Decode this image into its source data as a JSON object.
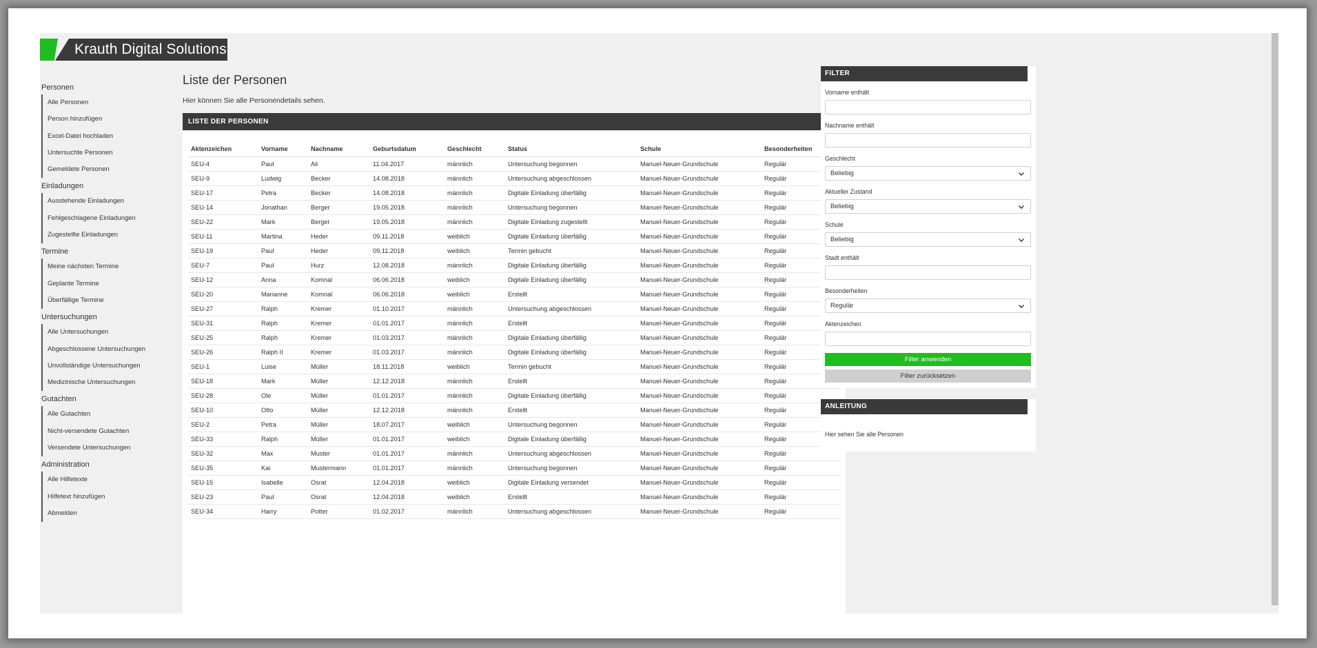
{
  "brand": {
    "name": "Krauth Digital Solutions",
    "accent": "#1fbd1f",
    "dark": "#3a3a3a"
  },
  "sidebar": {
    "sections": [
      {
        "title": "Personen",
        "items": [
          "Alle Personen",
          "Person hinzufügen",
          "Excel-Datei hochladen",
          "Untersuchte Personen",
          "Gemeldete Personen"
        ]
      },
      {
        "title": "Einladungen",
        "items": [
          "Ausstehende Einladungen",
          "Fehlgeschlagene Einladungen",
          "Zugestellte Einladungen"
        ]
      },
      {
        "title": "Termine",
        "items": [
          "Meine nächsten Termine",
          "Geplante Termine",
          "Überfällige Termine"
        ]
      },
      {
        "title": "Untersuchungen",
        "items": [
          "Alle Untersuchungen",
          "Abgeschlossene Untersuchungen",
          "Unvollständige Untersuchungen",
          "Medizinische Untersuchungen"
        ]
      },
      {
        "title": "Gutachten",
        "items": [
          "Alle Gutachten",
          "Nicht-versendete Gutachten",
          "Versendete Untersuchungen"
        ]
      },
      {
        "title": "Administration",
        "items": [
          "Alle Hilfetexte",
          "Hilfetext hinzufügen",
          "Abmelden"
        ]
      }
    ]
  },
  "main": {
    "title": "Liste der Personen",
    "subtitle": "Hier können Sie alle Personendetails sehen.",
    "panel_title": "LISTE DER PERSONEN",
    "columns": [
      "Aktenzeichen",
      "Vorname",
      "Nachname",
      "Geburtsdatum",
      "Geschlecht",
      "Status",
      "Schule",
      "Besonderheiten"
    ],
    "rows": [
      [
        "SEU-4",
        "Paul",
        "Ali",
        "11.04.2017",
        "männlich",
        "Untersuchung begonnen",
        "Manuel-Neuer-Grundschule",
        "Regulär"
      ],
      [
        "SEU-9",
        "Ludwig",
        "Becker",
        "14.08.2018",
        "männlich",
        "Untersuchung abgeschlossen",
        "Manuel-Neuer-Grundschule",
        "Regulär"
      ],
      [
        "SEU-17",
        "Petra",
        "Becker",
        "14.08.2018",
        "männlich",
        "Digitale Einladung überfällig",
        "Manuel-Neuer-Grundschule",
        "Regulär"
      ],
      [
        "SEU-14",
        "Jonathan",
        "Berger",
        "19.05.2018",
        "männlich",
        "Untersuchung begonnen",
        "Manuel-Neuer-Grundschule",
        "Regulär"
      ],
      [
        "SEU-22",
        "Mark",
        "Berger",
        "19.05.2018",
        "männlich",
        "Digitale Einladung zugestellt",
        "Manuel-Neuer-Grundschule",
        "Regulär"
      ],
      [
        "SEU-11",
        "Martina",
        "Heder",
        "09.11.2018",
        "weiblich",
        "Digitale Einladung überfällig",
        "Manuel-Neuer-Grundschule",
        "Regulär"
      ],
      [
        "SEU-19",
        "Paul",
        "Heder",
        "09.11.2018",
        "weiblich",
        "Termin gebucht",
        "Manuel-Neuer-Grundschule",
        "Regulär"
      ],
      [
        "SEU-7",
        "Paul",
        "Hurz",
        "12.08.2018",
        "männlich",
        "Digitale Einladung überfällig",
        "Manuel-Neuer-Grundschule",
        "Regulär"
      ],
      [
        "SEU-12",
        "Anna",
        "Komnal",
        "06.06.2018",
        "weiblich",
        "Digitale Einladung überfällig",
        "Manuel-Neuer-Grundschule",
        "Regulär"
      ],
      [
        "SEU-20",
        "Marianne",
        "Komnal",
        "06.06.2018",
        "weiblich",
        "Erstellt",
        "Manuel-Neuer-Grundschule",
        "Regulär"
      ],
      [
        "SEU-27",
        "Ralph",
        "Kremer",
        "01.10.2017",
        "männlich",
        "Untersuchung abgeschlossen",
        "Manuel-Neuer-Grundschule",
        "Regulär"
      ],
      [
        "SEU-31",
        "Ralph",
        "Kremer",
        "01.01.2017",
        "männlich",
        "Erstellt",
        "Manuel-Neuer-Grundschule",
        "Regulär"
      ],
      [
        "SEU-25",
        "Ralph",
        "Kremer",
        "01.03.2017",
        "männlich",
        "Digitale Einladung überfällig",
        "Manuel-Neuer-Grundschule",
        "Regulär"
      ],
      [
        "SEU-26",
        "Ralph II",
        "Kremer",
        "01.03.2017",
        "männlich",
        "Digitale Einladung überfällig",
        "Manuel-Neuer-Grundschule",
        "Regulär"
      ],
      [
        "SEU-1",
        "Luise",
        "Müller",
        "18.11.2018",
        "weiblich",
        "Termin gebucht",
        "Manuel-Neuer-Grundschule",
        "Regulär"
      ],
      [
        "SEU-18",
        "Mark",
        "Müller",
        "12.12.2018",
        "männlich",
        "Erstellt",
        "Manuel-Neuer-Grundschule",
        "Regulär"
      ],
      [
        "SEU-28",
        "Ole",
        "Müller",
        "01.01.2017",
        "männlich",
        "Digitale Einladung überfällig",
        "Manuel-Neuer-Grundschule",
        "Regulär"
      ],
      [
        "SEU-10",
        "Otto",
        "Müller",
        "12.12.2018",
        "männlich",
        "Erstellt",
        "Manuel-Neuer-Grundschule",
        "Regulär"
      ],
      [
        "SEU-2",
        "Petra",
        "Müller",
        "18.07.2017",
        "weiblich",
        "Untersuchung begonnen",
        "Manuel-Neuer-Grundschule",
        "Regulär"
      ],
      [
        "SEU-33",
        "Ralph",
        "Müller",
        "01.01.2017",
        "weiblich",
        "Digitale Einladung überfällig",
        "Manuel-Neuer-Grundschule",
        "Regulär"
      ],
      [
        "SEU-32",
        "Max",
        "Muster",
        "01.01.2017",
        "männlich",
        "Untersuchung abgeschlossen",
        "Manuel-Neuer-Grundschule",
        "Regulär"
      ],
      [
        "SEU-35",
        "Kai",
        "Mustermann",
        "01.01.2017",
        "männlich",
        "Untersuchung begonnen",
        "Manuel-Neuer-Grundschule",
        "Regulär"
      ],
      [
        "SEU-15",
        "Isabelle",
        "Osrat",
        "12.04.2018",
        "weiblich",
        "Digitale Einladung versendet",
        "Manuel-Neuer-Grundschule",
        "Regulär"
      ],
      [
        "SEU-23",
        "Paul",
        "Osrat",
        "12.04.2018",
        "weiblich",
        "Erstellt",
        "Manuel-Neuer-Grundschule",
        "Regulär"
      ],
      [
        "SEU-34",
        "Harry",
        "Potter",
        "01.02.2017",
        "männlich",
        "Untersuchung abgeschlossen",
        "Manuel-Neuer-Grundschule",
        "Regulär"
      ]
    ]
  },
  "filter": {
    "title": "FILTER",
    "vorname_label": "Vorname enthält",
    "vorname_value": "",
    "nachname_label": "Nachname enthält",
    "nachname_value": "",
    "geschlecht_label": "Geschlecht",
    "geschlecht_value": "Beliebig",
    "zustand_label": "Aktueller Zustand",
    "zustand_value": "Beliebig",
    "schule_label": "Schule",
    "schule_value": "Beliebig",
    "stadt_label": "Stadt enthält",
    "stadt_value": "",
    "besonderheiten_label": "Besonderheiten",
    "besonderheiten_value": "Regulär",
    "aktenzeichen_label": "Aktenzeichen",
    "aktenzeichen_value": "",
    "apply_label": "Filter anwenden",
    "reset_label": "Filter zurücksetzen"
  },
  "guide": {
    "title": "ANLEITUNG",
    "text": "Hier sehen Sie alle Personen"
  },
  "icons": {
    "select_arrow": "chevron-down-icon"
  }
}
